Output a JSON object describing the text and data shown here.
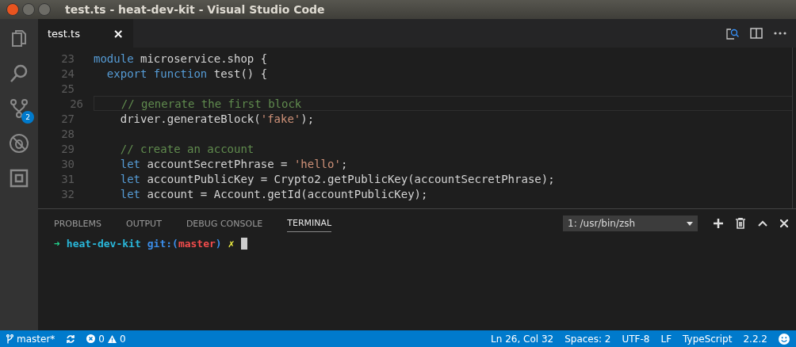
{
  "window": {
    "title": "test.ts - heat-dev-kit - Visual Studio Code"
  },
  "activity_bar": [
    {
      "kind": "files",
      "selected": false
    },
    {
      "kind": "search",
      "selected": false
    },
    {
      "kind": "git",
      "selected": false,
      "badge": "2"
    },
    {
      "kind": "debug",
      "selected": false
    },
    {
      "kind": "extensions",
      "selected": false
    }
  ],
  "tabs": [
    {
      "label": "test.ts",
      "close": "×",
      "selected": true
    }
  ],
  "editor": {
    "lines": [
      {
        "number": "23",
        "tokens": [
          {
            "kind": "keyword",
            "text": "module"
          },
          {
            "kind": "plain",
            "text": " microservice.shop {"
          }
        ]
      },
      {
        "number": "24",
        "tokens": [
          {
            "kind": "keyword",
            "text": "  export function"
          },
          {
            "kind": "plain",
            "text": " test() {"
          }
        ]
      },
      {
        "number": "25"
      },
      {
        "number": "26",
        "current": true,
        "tokens": [
          {
            "kind": "comment",
            "text": "    // generate the first block"
          }
        ]
      },
      {
        "number": "27",
        "tokens": [
          {
            "kind": "plain",
            "text": "    driver.generateBlock("
          },
          {
            "kind": "string",
            "text": "'fake'"
          },
          {
            "kind": "plain",
            "text": ");"
          }
        ]
      },
      {
        "number": "28"
      },
      {
        "number": "29",
        "tokens": [
          {
            "kind": "comment",
            "text": "    // create an account"
          }
        ]
      },
      {
        "number": "30",
        "tokens": [
          {
            "kind": "keyword",
            "text": "    let"
          },
          {
            "kind": "plain",
            "text": " accountSecretPhrase = "
          },
          {
            "kind": "string",
            "text": "'hello'"
          },
          {
            "kind": "plain",
            "text": ";"
          }
        ]
      },
      {
        "number": "31",
        "tokens": [
          {
            "kind": "keyword",
            "text": "    let"
          },
          {
            "kind": "plain",
            "text": " accountPublicKey = Crypto2.getPublicKey(accountSecretPhrase);"
          }
        ]
      },
      {
        "number": "32",
        "tokens": [
          {
            "kind": "keyword",
            "text": "    let"
          },
          {
            "kind": "plain",
            "text": " account = Account.getId(accountPublicKey);"
          }
        ]
      }
    ]
  },
  "panel": {
    "tabs": [
      {
        "label": "PROBLEMS",
        "selected": false
      },
      {
        "label": "OUTPUT",
        "selected": false
      },
      {
        "label": "DEBUG CONSOLE",
        "selected": false
      },
      {
        "label": "TERMINAL",
        "selected": true
      }
    ],
    "terminal_select": "1: /usr/bin/zsh",
    "terminal": [
      {
        "kind": "arrow",
        "text": "➜"
      },
      {
        "kind": "dir",
        "text": "heat-dev-kit"
      },
      {
        "kind": "git",
        "text": "git:("
      },
      {
        "kind": "branch",
        "text": "master"
      },
      {
        "kind": "git",
        "text": ")"
      },
      {
        "kind": "dirty",
        "text": "✗"
      }
    ]
  },
  "status_bar": {
    "branch": "master*",
    "errors": "0",
    "warnings": "0",
    "position": "Ln 26, Col 32",
    "spaces": "Spaces: 2",
    "encoding": "UTF-8",
    "eol": "LF",
    "language": "TypeScript",
    "version": "2.2.2"
  }
}
